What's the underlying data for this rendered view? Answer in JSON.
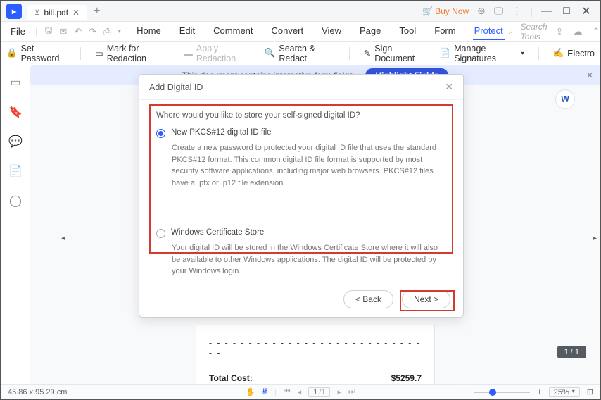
{
  "titlebar": {
    "tab_name": "bill.pdf",
    "buy_label": "Buy Now"
  },
  "menubar": {
    "file": "File",
    "tabs": [
      "Home",
      "Edit",
      "Comment",
      "Convert",
      "View",
      "Page",
      "Tool",
      "Form",
      "Protect"
    ],
    "active_index": 8,
    "search_placeholder": "Search Tools"
  },
  "ribbon": {
    "set_password": "Set Password",
    "mark_redaction": "Mark for Redaction",
    "apply_redaction": "Apply Redaction",
    "search_redact": "Search & Redact",
    "sign_document": "Sign Document",
    "manage_signatures": "Manage Signatures",
    "electronic": "Electro"
  },
  "banner": {
    "text": "This document contains interactive form fields.",
    "button": "Highlight Fields"
  },
  "modal": {
    "title": "Add Digital ID",
    "prompt": "Where would you like to store your self-signed digital ID?",
    "opt1_label": "New PKCS#12 digital ID file",
    "opt1_desc": "Create a new password to protected your digital ID file that uses the standard PKCS#12 format. This common digital ID file format is supported by most security software applications, including major web browsers. PKCS#12 files have a .pfx or .p12 file extension.",
    "opt2_label": "Windows Certificate Store",
    "opt2_desc": "Your digital ID will be stored in the Windows Certificate Store where it will also be available to other Windows applications. The digital ID will be protected by your Windows login.",
    "back": "< Back",
    "next": "Next >"
  },
  "document": {
    "total_cost_label": "Total Cost:",
    "total_cost_value": "$5259.7",
    "page_badge": "1 / 1"
  },
  "status": {
    "cursor": "45.86 x 95.29 cm",
    "page_current": "1",
    "page_total": "/1",
    "zoom": "25%"
  }
}
